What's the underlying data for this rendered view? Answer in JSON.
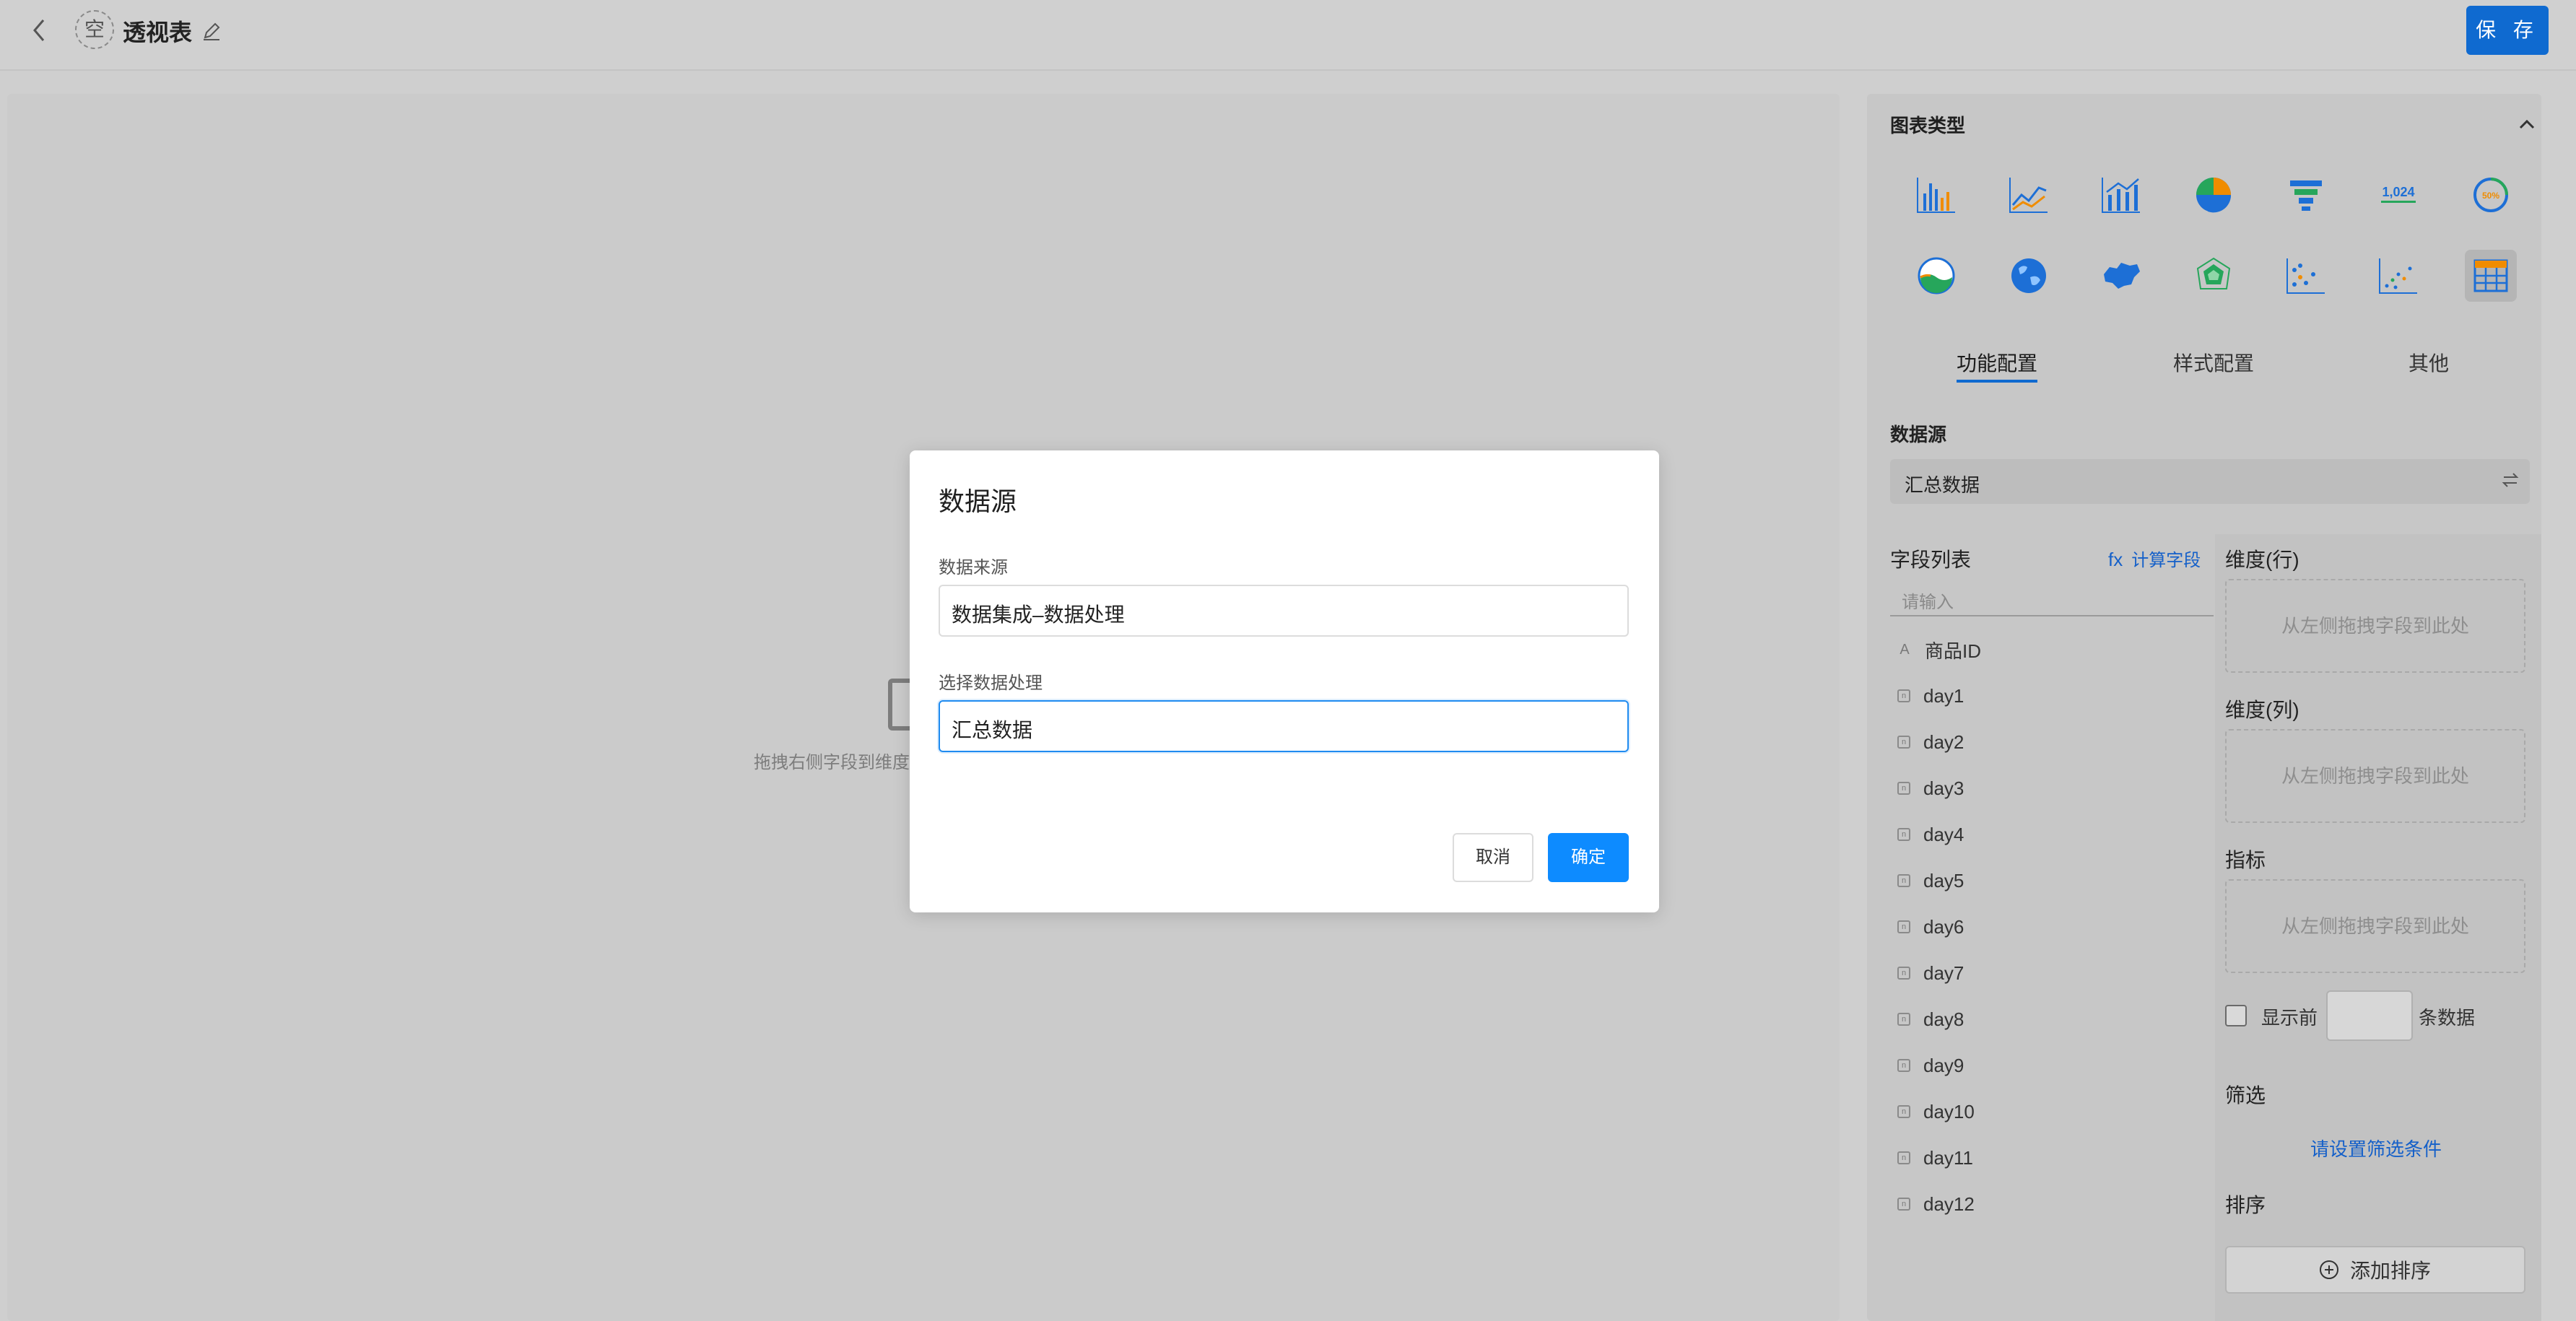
{
  "header": {
    "avatar_text": "空",
    "title": "透视表",
    "save_label": "保 存"
  },
  "canvas": {
    "placeholder": "拖拽右侧字段到维度"
  },
  "panel": {
    "chart_type_title": "图表类型",
    "chart_types": [
      "bar-chart-icon",
      "line-chart-icon",
      "bar-line-combo-icon",
      "pie-chart-icon",
      "funnel-chart-icon",
      "number-card-icon",
      "gauge-icon",
      "liquid-fill-icon",
      "world-map-icon",
      "china-map-icon",
      "radar-chart-icon",
      "scatter-chart-icon",
      "bubble-scatter-icon",
      "pivot-table-icon"
    ],
    "number_card_text": "1,024",
    "gauge_text": "50%",
    "tabs": [
      "功能配置",
      "样式配置",
      "其他"
    ],
    "datasource_label": "数据源",
    "datasource_value": "汇总数据",
    "field_list_title": "字段列表",
    "calc_field": "计算字段",
    "calc_prefix": "fx",
    "search_placeholder": "请输入",
    "fields": [
      {
        "type": "A",
        "name": "商品ID"
      },
      {
        "type": "n",
        "name": "day1"
      },
      {
        "type": "n",
        "name": "day2"
      },
      {
        "type": "n",
        "name": "day3"
      },
      {
        "type": "n",
        "name": "day4"
      },
      {
        "type": "n",
        "name": "day5"
      },
      {
        "type": "n",
        "name": "day6"
      },
      {
        "type": "n",
        "name": "day7"
      },
      {
        "type": "n",
        "name": "day8"
      },
      {
        "type": "n",
        "name": "day9"
      },
      {
        "type": "n",
        "name": "day10"
      },
      {
        "type": "n",
        "name": "day11"
      },
      {
        "type": "n",
        "name": "day12"
      }
    ],
    "dim_row": "维度(行)",
    "dim_col": "维度(列)",
    "metric": "指标",
    "drop_hint": "从左侧拖拽字段到此处",
    "show_top": "显示前",
    "top_suffix": "条数据",
    "filter_title": "筛选",
    "filter_link": "请设置筛选条件",
    "sort_title": "排序",
    "add_sort": "添加排序"
  },
  "modal": {
    "title": "数据源",
    "source_label": "数据来源",
    "source_value": "数据集成–数据处理",
    "process_label": "选择数据处理",
    "process_value": "汇总数据",
    "cancel": "取消",
    "ok": "确定"
  }
}
